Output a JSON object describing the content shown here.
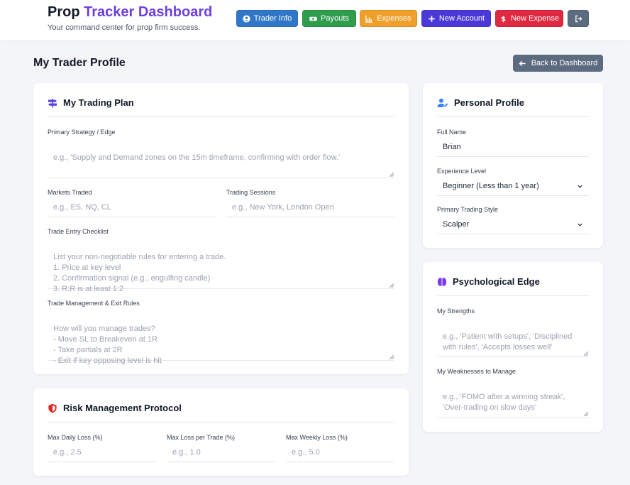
{
  "header": {
    "brand_primary": "Prop",
    "brand_accent": "Tracker Dashboard",
    "tagline": "Your command center for prop firm success.",
    "nav": [
      {
        "label": "Trader Info",
        "icon": "user-circle-icon",
        "color": "#3077c9"
      },
      {
        "label": "Payouts",
        "icon": "money-icon",
        "color": "#2f9d4c"
      },
      {
        "label": "Expenses",
        "icon": "chart-bar-icon",
        "color": "#f0a02a"
      },
      {
        "label": "New Account",
        "icon": "plus-icon",
        "color": "#4b38d8"
      },
      {
        "label": "New Expense",
        "icon": "dollar-icon",
        "color": "#e02840"
      },
      {
        "label": "",
        "icon": "sign-out-icon",
        "color": "#5d6b80"
      }
    ]
  },
  "page": {
    "title": "My Trader Profile",
    "back_label": "Back to Dashboard"
  },
  "trading_plan": {
    "title": "My Trading Plan",
    "strategy_label": "Primary Strategy / Edge",
    "strategy_placeholder": "e.g., 'Supply and Demand zones on the 15m timeframe, confirming with order flow.'",
    "markets_label": "Markets Traded",
    "markets_placeholder": "e.g., ES, NQ, CL",
    "sessions_label": "Trading Sessions",
    "sessions_placeholder": "e.g., New York, London Open",
    "checklist_label": "Trade Entry Checklist",
    "checklist_placeholder": "List your non-negotiable rules for entering a trade.\n1. Price at key level\n2. Confirmation signal (e.g., engulfing candle)\n3. R:R is at least 1:2",
    "management_label": "Trade Management & Exit Rules",
    "management_placeholder": "How will you manage trades?\n- Move SL to Breakeven at 1R\n- Take partials at 2R\n- Exit if key opposing level is hit"
  },
  "risk": {
    "title": "Risk Management Protocol",
    "daily_label": "Max Daily Loss (%)",
    "daily_placeholder": "e.g., 2.5",
    "per_trade_label": "Max Loss per Trade (%)",
    "per_trade_placeholder": "e.g., 1.0",
    "weekly_label": "Max Weekly Loss (%)",
    "weekly_placeholder": "e.g., 5.0"
  },
  "personal": {
    "title": "Personal Profile",
    "name_label": "Full Name",
    "name_value": "Brian",
    "experience_label": "Experience Level",
    "experience_value": "Beginner (Less than 1 year)",
    "style_label": "Primary Trading Style",
    "style_value": "Scalper"
  },
  "psych": {
    "title": "Psychological Edge",
    "strengths_label": "My Strengths",
    "strengths_placeholder": "e.g., 'Patient with setups', 'Disciplined with rules', 'Accepts losses well'",
    "weaknesses_label": "My Weaknesses to Manage",
    "weaknesses_placeholder": "e.g., 'FOMO after a winning streak', 'Over-trading on slow days'"
  }
}
